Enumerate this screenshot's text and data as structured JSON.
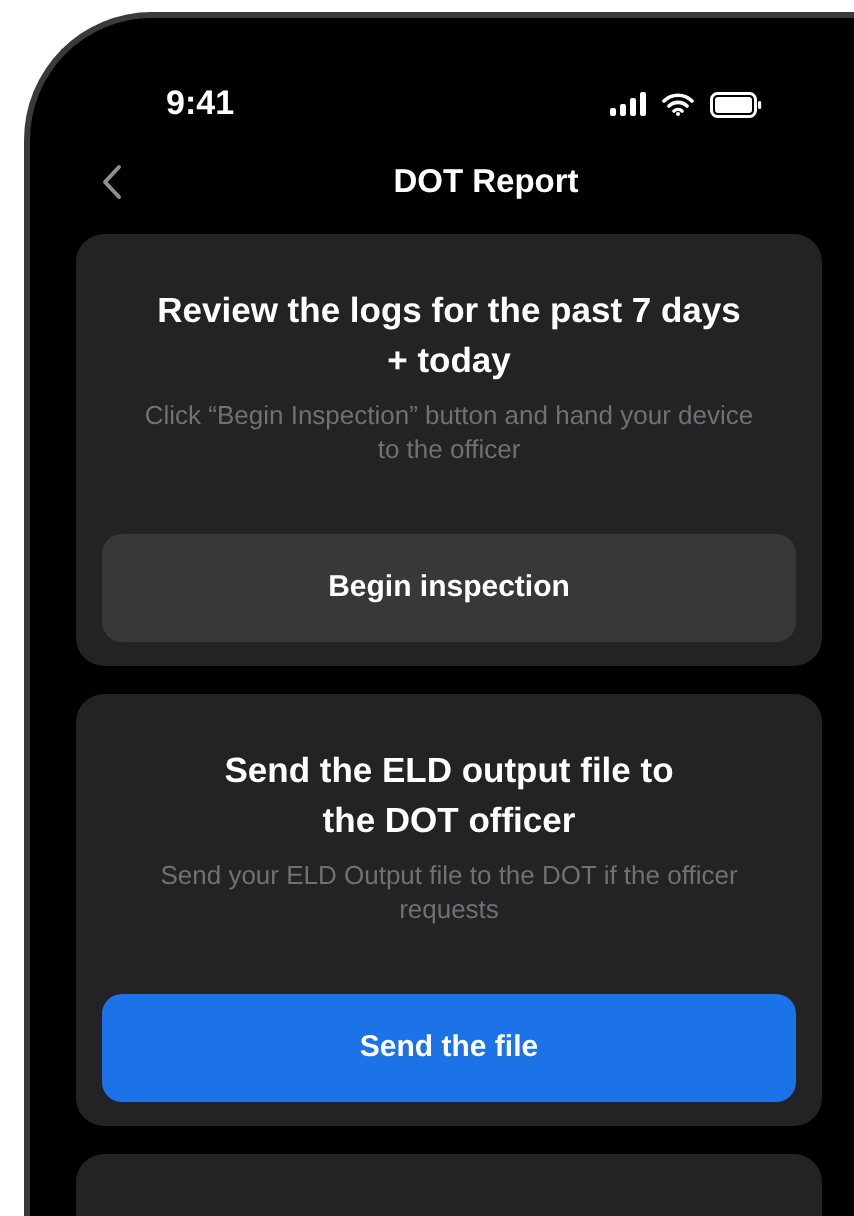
{
  "status_bar": {
    "time": "9:41"
  },
  "header": {
    "title": "DOT Report"
  },
  "cards": [
    {
      "title_lines": [
        "Review the logs for the past 7 days",
        "+ today"
      ],
      "description_lines": [
        "Click “Begin Inspection” button and hand your device",
        "to the officer"
      ],
      "button": {
        "label": "Begin inspection",
        "kind": "secondary"
      }
    },
    {
      "title_lines": [
        "Send the ELD output file to",
        "the DOT officer"
      ],
      "description_lines": [
        "Send your ELD Output file to the DOT if the officer",
        "requests"
      ],
      "button": {
        "label": "Send the file",
        "kind": "primary"
      }
    }
  ]
}
